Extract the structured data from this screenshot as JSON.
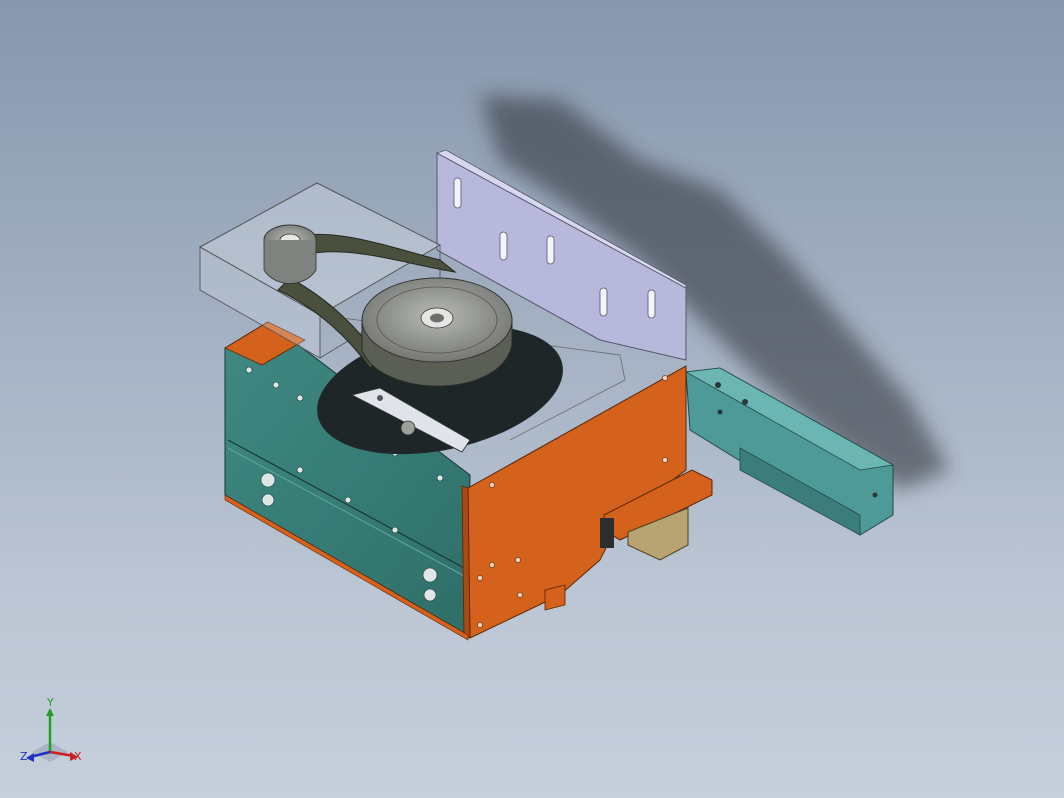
{
  "viewport": {
    "background_top": "#8797ad",
    "background_bottom": "#c6cfdc"
  },
  "model": {
    "colors": {
      "orange_plate": "#d4621c",
      "teal_plate": "#3f8a83",
      "teal_rail": "#4e9a98",
      "lavender_plate": "#b7b8dc",
      "belt": "#4a4f3e",
      "pulley": "#8c8e8a",
      "disc": "#1f2627",
      "motor_brass": "#b8a372"
    }
  },
  "triad": {
    "x_label": "X",
    "y_label": "Y",
    "z_label": "Z",
    "x_color": "#cc2020",
    "y_color": "#20a020",
    "z_color": "#2030c0"
  }
}
